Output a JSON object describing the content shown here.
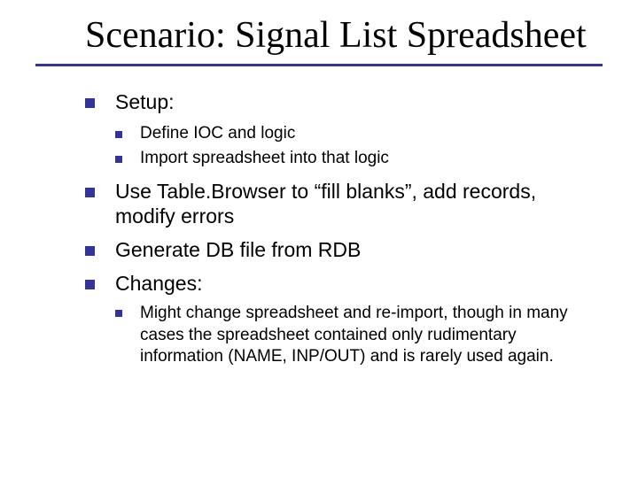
{
  "title": "Scenario: Signal List Spreadsheet",
  "bullets": {
    "b1": "Setup:",
    "b1_1": "Define IOC and logic",
    "b1_2": "Import spreadsheet into that logic",
    "b2": "Use Table.Browser to “fill blanks”, add records, modify errors",
    "b3": "Generate DB file from RDB",
    "b4": "Changes:",
    "b4_1": "Might change spreadsheet and re-import, though in many cases the spreadsheet contained only rudimentary information (NAME, INP/OUT) and is rarely used again."
  },
  "colors": {
    "accent": "#333399"
  }
}
